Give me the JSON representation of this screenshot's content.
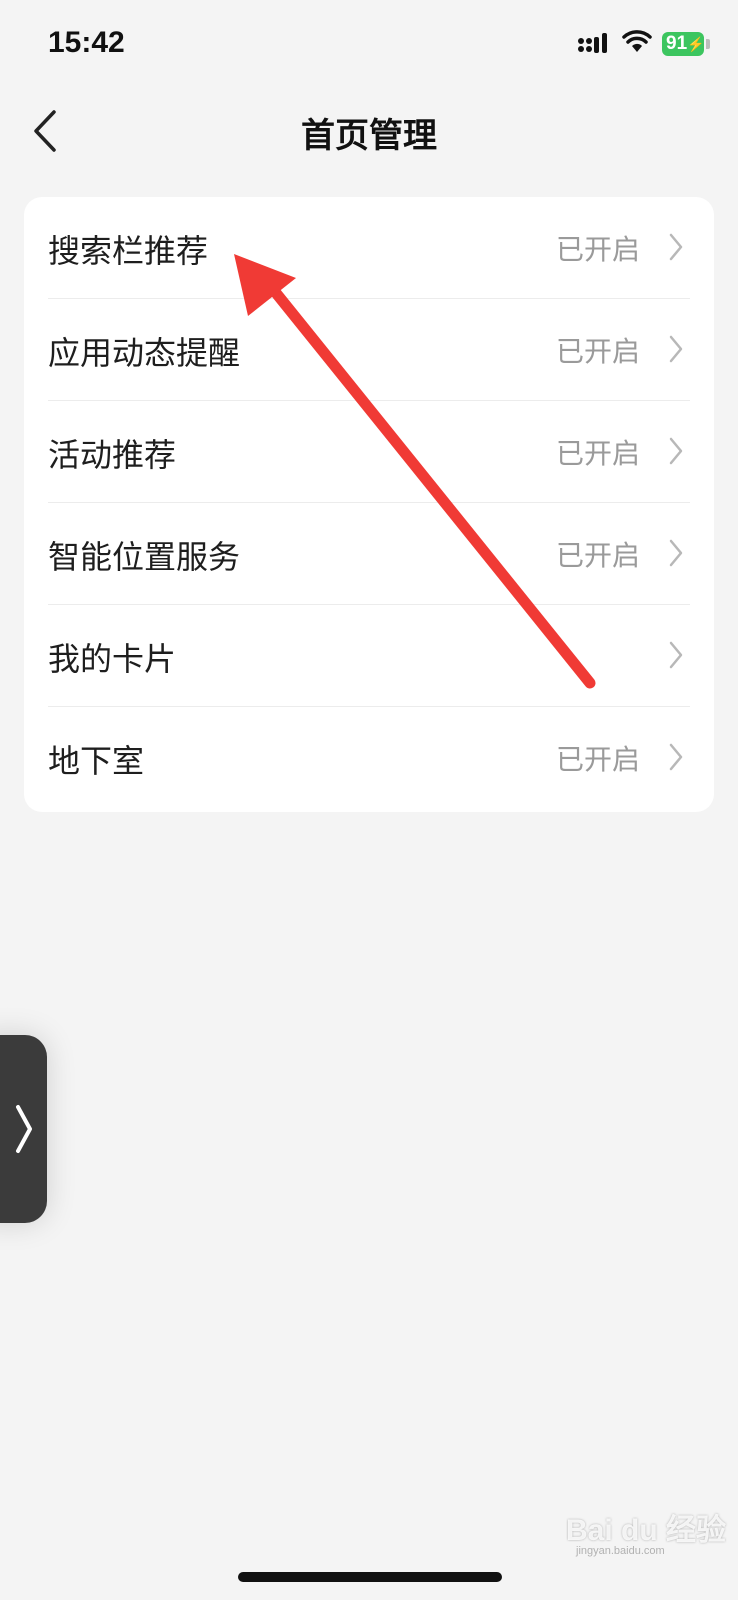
{
  "status_bar": {
    "time": "15:42",
    "battery_level": "91",
    "icons": [
      "signal-icon",
      "wifi-icon",
      "battery-icon"
    ]
  },
  "nav": {
    "title": "首页管理",
    "back_icon": "chevron-left-icon"
  },
  "settings": {
    "items": [
      {
        "label": "搜索栏推荐",
        "value": "已开启"
      },
      {
        "label": "应用动态提醒",
        "value": "已开启"
      },
      {
        "label": "活动推荐",
        "value": "已开启"
      },
      {
        "label": "智能位置服务",
        "value": "已开启"
      },
      {
        "label": "我的卡片",
        "value": ""
      },
      {
        "label": "地下室",
        "value": "已开启"
      }
    ]
  },
  "annotation": {
    "arrow_color": "#f03a35"
  },
  "watermark": {
    "brand": "Bai du 经验",
    "url": "jingyan.baidu.com"
  },
  "colors": {
    "background": "#f4f4f4",
    "card": "#ffffff",
    "battery": "#3cc55f",
    "value_text": "#9a9a9a"
  }
}
